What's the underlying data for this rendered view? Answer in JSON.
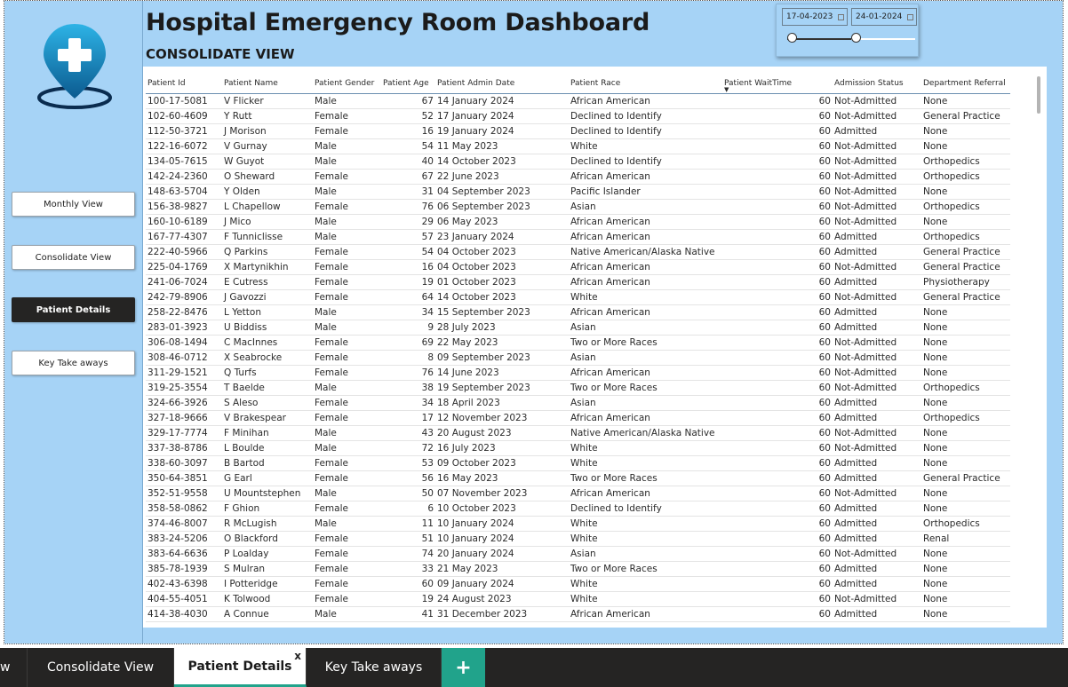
{
  "header": {
    "title": "Hospital Emergency Room Dashboard",
    "subtitle": "CONSOLIDATE VIEW"
  },
  "date_slicer": {
    "start": "17-04-2023",
    "end": "24-01-2024"
  },
  "sidebar": {
    "logo_icon": "hospital-location-pin-icon",
    "buttons": [
      {
        "label": "Monthly View",
        "active": false
      },
      {
        "label": "Consolidate View",
        "active": false
      },
      {
        "label": "Patient Details",
        "active": true
      },
      {
        "label": "Key Take aways",
        "active": false
      }
    ]
  },
  "table": {
    "columns": [
      "Patient Id",
      "Patient Name",
      "Patient Gender",
      "Patient Age",
      "Patient Admin Date",
      "Patient Race",
      "Patient WaitTime",
      "Admission Status",
      "Department Referral"
    ],
    "sorted_column": "Patient WaitTime",
    "rows": [
      [
        "100-17-5081",
        "V Flicker",
        "Male",
        "67",
        "14 January 2024",
        "African American",
        "60",
        "Not-Admitted",
        "None"
      ],
      [
        "102-60-4609",
        "Y Rutt",
        "Female",
        "52",
        "17 January 2024",
        "Declined to Identify",
        "60",
        "Not-Admitted",
        "General Practice"
      ],
      [
        "112-50-3721",
        "J Morison",
        "Female",
        "16",
        "19 January 2024",
        "Declined to Identify",
        "60",
        "Admitted",
        "None"
      ],
      [
        "122-16-6072",
        "V Gurnay",
        "Male",
        "54",
        "11 May 2023",
        "White",
        "60",
        "Not-Admitted",
        "None"
      ],
      [
        "134-05-7615",
        "W Guyot",
        "Male",
        "40",
        "14 October 2023",
        "Declined to Identify",
        "60",
        "Not-Admitted",
        "Orthopedics"
      ],
      [
        "142-24-2360",
        "O Sheward",
        "Female",
        "67",
        "22 June 2023",
        "African American",
        "60",
        "Not-Admitted",
        "Orthopedics"
      ],
      [
        "148-63-5704",
        "Y Olden",
        "Male",
        "31",
        "04 September 2023",
        "Pacific Islander",
        "60",
        "Not-Admitted",
        "None"
      ],
      [
        "156-38-9827",
        "L Chapellow",
        "Female",
        "76",
        "06 September 2023",
        "Asian",
        "60",
        "Not-Admitted",
        "Orthopedics"
      ],
      [
        "160-10-6189",
        "J Mico",
        "Male",
        "29",
        "06 May 2023",
        "African American",
        "60",
        "Not-Admitted",
        "None"
      ],
      [
        "167-77-4307",
        "F Tunniclisse",
        "Male",
        "57",
        "23 January 2024",
        "African American",
        "60",
        "Admitted",
        "Orthopedics"
      ],
      [
        "222-40-5966",
        "Q Parkins",
        "Female",
        "54",
        "04 October 2023",
        "Native American/Alaska Native",
        "60",
        "Admitted",
        "General Practice"
      ],
      [
        "225-04-1769",
        "X Martynikhin",
        "Female",
        "16",
        "04 October 2023",
        "African American",
        "60",
        "Not-Admitted",
        "General Practice"
      ],
      [
        "241-06-7024",
        "E Cutress",
        "Female",
        "19",
        "01 October 2023",
        "African American",
        "60",
        "Admitted",
        "Physiotherapy"
      ],
      [
        "242-79-8906",
        "J Gavozzi",
        "Female",
        "64",
        "14 October 2023",
        "White",
        "60",
        "Not-Admitted",
        "General Practice"
      ],
      [
        "258-22-8476",
        "L Yetton",
        "Male",
        "34",
        "15 September 2023",
        "African American",
        "60",
        "Admitted",
        "None"
      ],
      [
        "283-01-3923",
        "U Biddiss",
        "Male",
        "9",
        "28 July 2023",
        "Asian",
        "60",
        "Admitted",
        "None"
      ],
      [
        "306-08-1494",
        "C MacInnes",
        "Female",
        "69",
        "22 May 2023",
        "Two or More Races",
        "60",
        "Not-Admitted",
        "None"
      ],
      [
        "308-46-0712",
        "X Seabrocke",
        "Female",
        "8",
        "09 September 2023",
        "Asian",
        "60",
        "Not-Admitted",
        "None"
      ],
      [
        "311-29-1521",
        "Q Turfs",
        "Female",
        "76",
        "14 June 2023",
        "African American",
        "60",
        "Not-Admitted",
        "None"
      ],
      [
        "319-25-3554",
        "T Baelde",
        "Male",
        "38",
        "19 September 2023",
        "Two or More Races",
        "60",
        "Not-Admitted",
        "Orthopedics"
      ],
      [
        "324-66-3926",
        "S Aleso",
        "Female",
        "34",
        "18 April 2023",
        "Asian",
        "60",
        "Admitted",
        "None"
      ],
      [
        "327-18-9666",
        "V Brakespear",
        "Female",
        "17",
        "12 November 2023",
        "African American",
        "60",
        "Admitted",
        "Orthopedics"
      ],
      [
        "329-17-7774",
        "F Minihan",
        "Male",
        "43",
        "20 August 2023",
        "Native American/Alaska Native",
        "60",
        "Not-Admitted",
        "None"
      ],
      [
        "337-38-8786",
        "L Boulde",
        "Male",
        "72",
        "16 July 2023",
        "White",
        "60",
        "Not-Admitted",
        "None"
      ],
      [
        "338-60-3097",
        "B Bartod",
        "Female",
        "53",
        "09 October 2023",
        "White",
        "60",
        "Admitted",
        "None"
      ],
      [
        "350-64-3851",
        "G Earl",
        "Female",
        "56",
        "16 May 2023",
        "Two or More Races",
        "60",
        "Admitted",
        "General Practice"
      ],
      [
        "352-51-9558",
        "U Mountstephen",
        "Male",
        "50",
        "07 November 2023",
        "African American",
        "60",
        "Not-Admitted",
        "None"
      ],
      [
        "358-58-0862",
        "F Ghion",
        "Female",
        "6",
        "10 October 2023",
        "Declined to Identify",
        "60",
        "Admitted",
        "None"
      ],
      [
        "374-46-8007",
        "R McLugish",
        "Male",
        "11",
        "10 January 2024",
        "White",
        "60",
        "Admitted",
        "Orthopedics"
      ],
      [
        "383-24-5206",
        "O Blackford",
        "Female",
        "51",
        "10 January 2024",
        "White",
        "60",
        "Admitted",
        "Renal"
      ],
      [
        "383-64-6636",
        "P Loalday",
        "Female",
        "74",
        "20 January 2024",
        "Asian",
        "60",
        "Not-Admitted",
        "None"
      ],
      [
        "385-78-1939",
        "S Mulran",
        "Female",
        "33",
        "21 May 2023",
        "Two or More Races",
        "60",
        "Admitted",
        "None"
      ],
      [
        "402-43-6398",
        "I Potteridge",
        "Female",
        "60",
        "09 January 2024",
        "White",
        "60",
        "Admitted",
        "None"
      ],
      [
        "404-55-4051",
        "K Tolwood",
        "Female",
        "19",
        "24 August 2023",
        "White",
        "60",
        "Not-Admitted",
        "None"
      ],
      [
        "414-38-4030",
        "A Connue",
        "Male",
        "41",
        "31 December 2023",
        "African American",
        "60",
        "Admitted",
        "None"
      ]
    ]
  },
  "tabs": [
    {
      "label": "w",
      "active": false
    },
    {
      "label": "Consolidate View",
      "active": false
    },
    {
      "label": "Patient Details",
      "active": true,
      "close": "x"
    },
    {
      "label": "Key Take aways",
      "active": false
    }
  ],
  "add_tab_label": "+",
  "colors": {
    "panel": "#a6d3f6",
    "accent": "#21a38b",
    "dark": "#252423",
    "logo_blue": "#1b8fc9"
  }
}
